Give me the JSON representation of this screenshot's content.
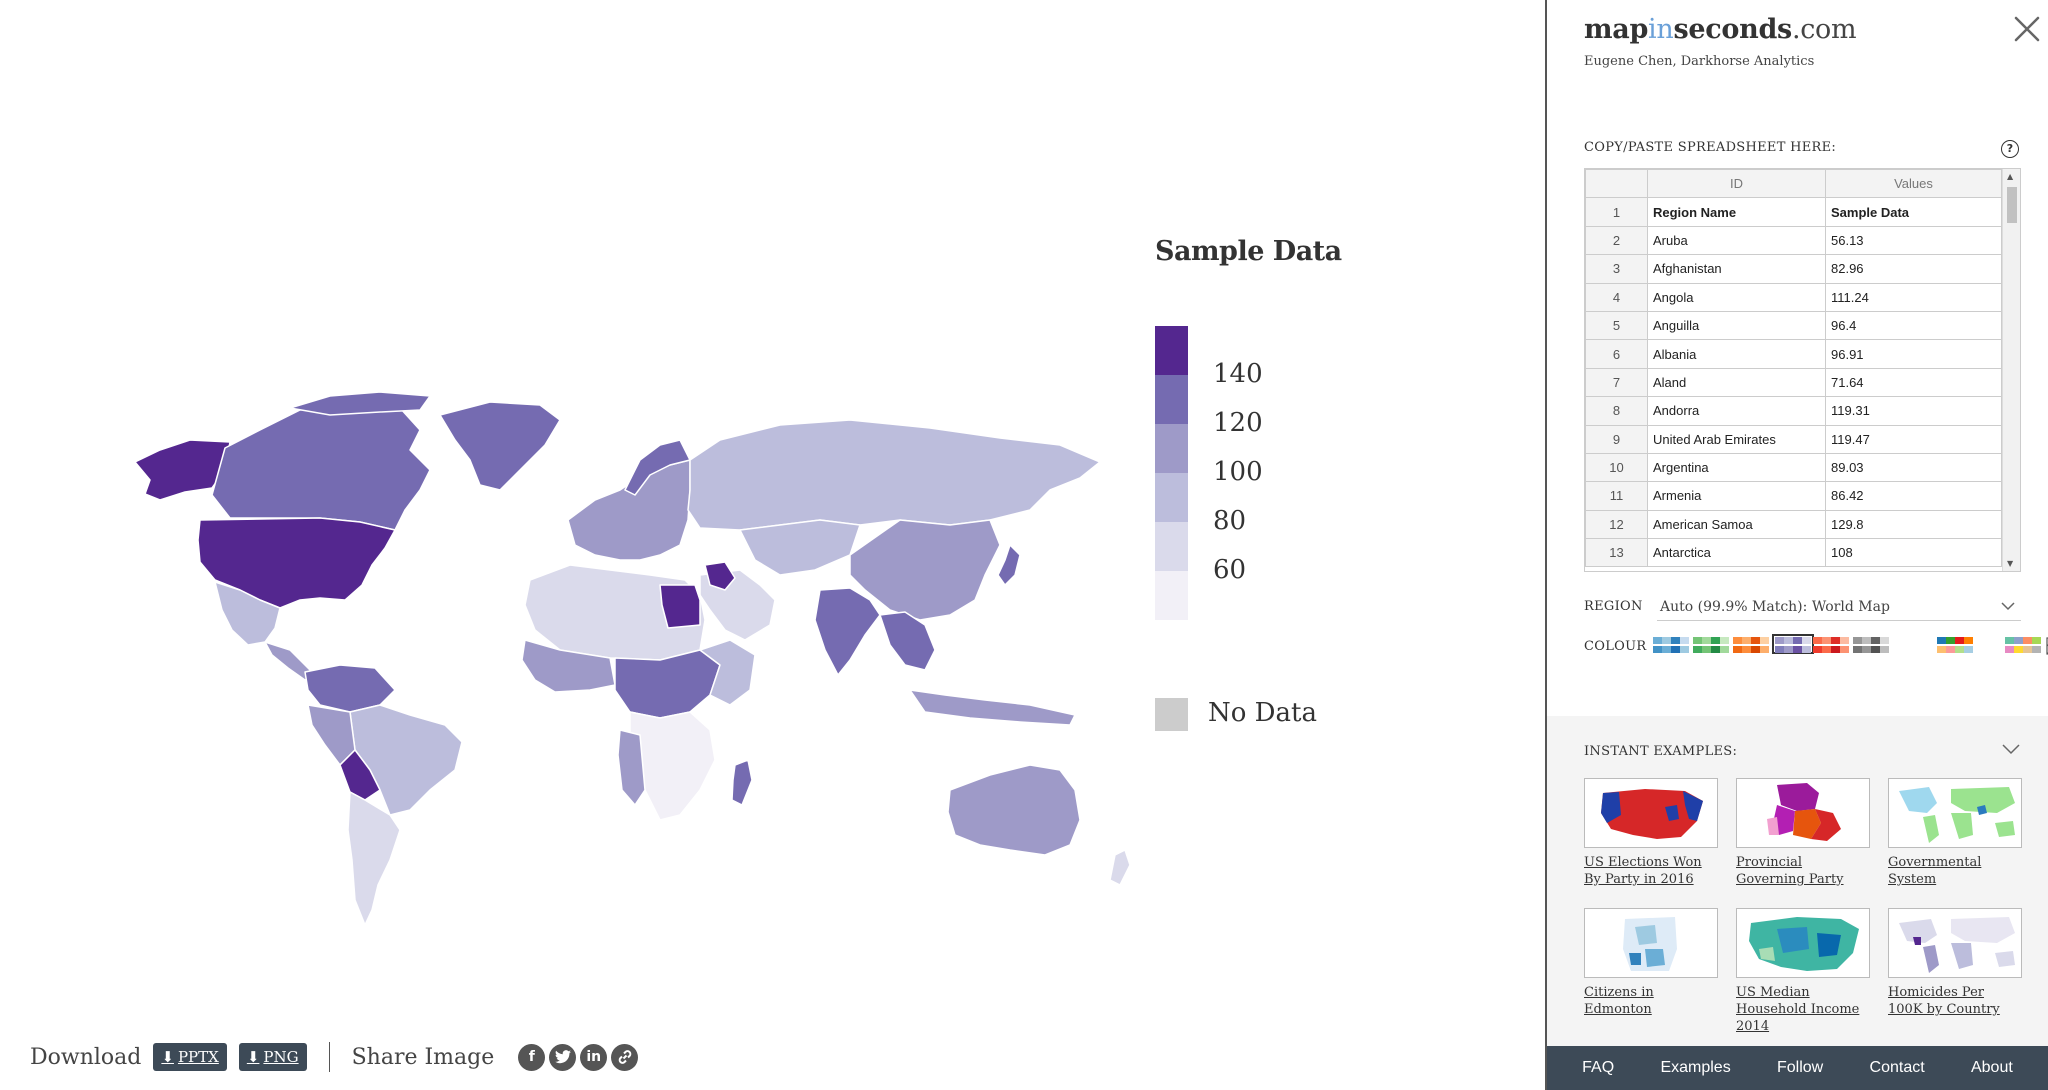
{
  "legend": {
    "title": "Sample Data",
    "scale": [
      {
        "label": "",
        "color": "#54278f"
      },
      {
        "label": "140",
        "color": "#756bb1"
      },
      {
        "label": "120",
        "color": "#9e9ac8"
      },
      {
        "label": "100",
        "color": "#bcbddc"
      },
      {
        "label": "80",
        "color": "#dadaeb"
      },
      {
        "label": "60",
        "color": "#f2f0f7"
      }
    ],
    "no_data_label": "No Data",
    "no_data_color": "#cccccc"
  },
  "bottom_bar": {
    "download_label": "Download",
    "pptx_label": "PPTX",
    "png_label": "PNG",
    "share_label": "Share Image",
    "share_icons": [
      "facebook-icon",
      "twitter-icon",
      "linkedin-icon",
      "link-icon"
    ]
  },
  "panel": {
    "brand": {
      "part1": "map",
      "part2": "in",
      "part3": "seconds",
      "part4": ".com"
    },
    "credit": "Eugene Chen, Darkhorse Analytics",
    "sheet_label": "COPY/PASTE SPREADSHEET HERE:",
    "help_glyph": "?",
    "sheet": {
      "columns": [
        "ID",
        "Values"
      ],
      "rows": [
        {
          "n": "1",
          "id": "Region Name",
          "val": "Sample Data"
        },
        {
          "n": "2",
          "id": "Aruba",
          "val": "56.13"
        },
        {
          "n": "3",
          "id": "Afghanistan",
          "val": "82.96"
        },
        {
          "n": "4",
          "id": "Angola",
          "val": "111.24"
        },
        {
          "n": "5",
          "id": "Anguilla",
          "val": "96.4"
        },
        {
          "n": "6",
          "id": "Albania",
          "val": "96.91"
        },
        {
          "n": "7",
          "id": "Aland",
          "val": "71.64"
        },
        {
          "n": "8",
          "id": "Andorra",
          "val": "119.31"
        },
        {
          "n": "9",
          "id": "United Arab Emirates",
          "val": "119.47"
        },
        {
          "n": "10",
          "id": "Argentina",
          "val": "89.03"
        },
        {
          "n": "11",
          "id": "Armenia",
          "val": "86.42"
        },
        {
          "n": "12",
          "id": "American Samoa",
          "val": "129.8"
        },
        {
          "n": "13",
          "id": "Antarctica",
          "val": "108"
        }
      ]
    },
    "region_label": "REGION",
    "region_value": "Auto (99.9% Match): World Map",
    "colour_label": "COLOUR",
    "palettes": [
      {
        "colors": [
          "#6baed6",
          "#9ecae1",
          "#3182bd",
          "#c6dbef"
        ],
        "rows2": [
          "#4292c6",
          "#6baed6",
          "#2171b5",
          "#9ecae1"
        ]
      },
      {
        "colors": [
          "#74c476",
          "#a1d99b",
          "#31a354",
          "#c7e9c0"
        ],
        "rows2": [
          "#41ab5d",
          "#74c476",
          "#238b45",
          "#a1d99b"
        ]
      },
      {
        "colors": [
          "#fd8d3c",
          "#fdae6b",
          "#e6550d",
          "#fdd0a2"
        ],
        "rows2": [
          "#f16913",
          "#fd8d3c",
          "#d94801",
          "#fdae6b"
        ]
      },
      {
        "colors": [
          "#9e9ac8",
          "#bcbddc",
          "#756bb1",
          "#dadaeb"
        ],
        "rows2": [
          "#807dba",
          "#9e9ac8",
          "#6a51a3",
          "#bcbddc"
        ]
      },
      {
        "colors": [
          "#fb6a4a",
          "#fc9272",
          "#de2d26",
          "#fcbba1"
        ],
        "rows2": [
          "#ef3b2c",
          "#fb6a4a",
          "#cb181d",
          "#fc9272"
        ]
      },
      {
        "colors": [
          "#969696",
          "#bdbdbd",
          "#636363",
          "#d9d9d9"
        ],
        "rows2": [
          "#737373",
          "#969696",
          "#525252",
          "#bdbdbd"
        ]
      },
      {
        "colors": [
          "#1f78b4",
          "#33a02c",
          "#e31a1c",
          "#ff7f00"
        ],
        "rows2": [
          "#fdbf6f",
          "#fb9a99",
          "#b2df8a",
          "#a6cee3"
        ]
      },
      {
        "colors": [
          "#66c2a5",
          "#8da0cb",
          "#fc8d62",
          "#a6d854"
        ],
        "rows2": [
          "#e78ac3",
          "#ffd92f",
          "#e5c494",
          "#b3b3b3"
        ]
      }
    ],
    "examples_label": "INSTANT EXAMPLES:",
    "examples": [
      {
        "caption": "US Elections Won By Party in 2016"
      },
      {
        "caption": "Provincial Governing Party"
      },
      {
        "caption": "Governmental System"
      },
      {
        "caption": "Citizens in Edmonton"
      },
      {
        "caption": "US Median Household Income 2014"
      },
      {
        "caption": "Homicides Per 100K by Country"
      }
    ],
    "footer": [
      "FAQ",
      "Examples",
      "Follow",
      "Contact",
      "About"
    ]
  }
}
